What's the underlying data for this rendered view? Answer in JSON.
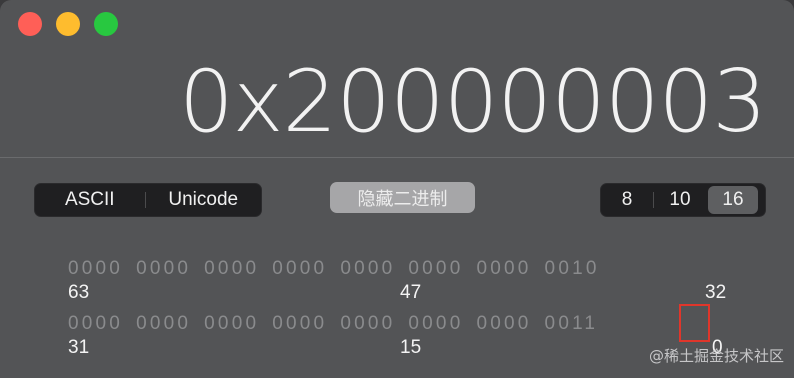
{
  "display": {
    "value": "0x200000003"
  },
  "encoding": {
    "ascii": "ASCII",
    "unicode": "Unicode"
  },
  "hide_binary": "隐藏二进制",
  "radix": {
    "oct": "8",
    "dec": "10",
    "hex": "16",
    "selected": "16"
  },
  "bits": {
    "high_row": [
      "0000",
      "0000",
      "0000",
      "0000",
      "0000",
      "0000",
      "0000",
      "0010"
    ],
    "low_row": [
      "0000",
      "0000",
      "0000",
      "0000",
      "0000",
      "0000",
      "0000",
      "0011"
    ],
    "high_labels": {
      "left": "63",
      "mid": "47",
      "right": "32"
    },
    "low_labels": {
      "left": "31",
      "mid": "15",
      "right": "0"
    }
  },
  "watermark": "@稀土掘金技术社区",
  "colors": {
    "close": "#ff5f57",
    "minimize": "#febc2e",
    "maximize": "#28c840",
    "highlight": "#e0362b"
  }
}
